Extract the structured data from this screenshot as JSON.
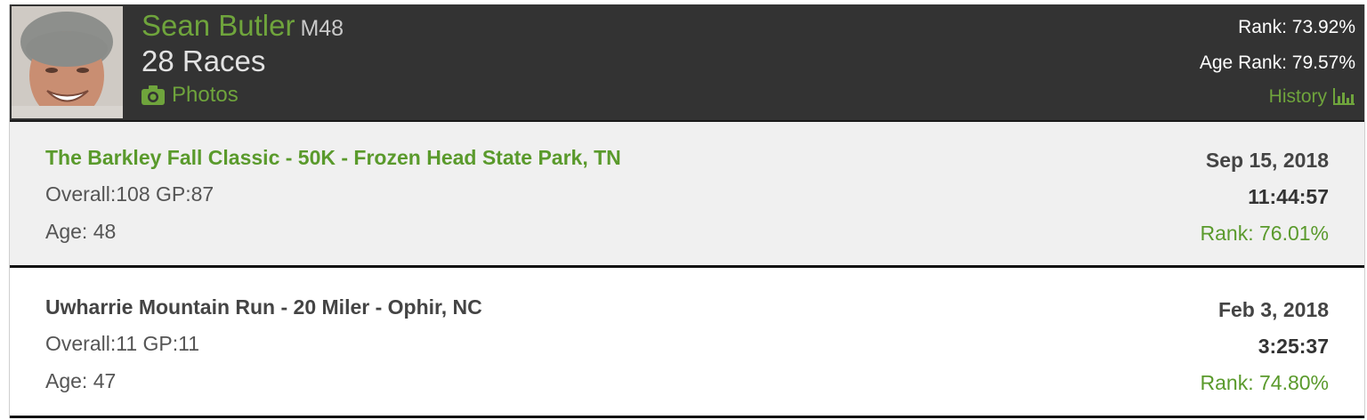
{
  "runner": {
    "name": "Sean Butler",
    "age_group": "M48",
    "races": "28 Races",
    "photos_label": "Photos",
    "rank": "Rank: 73.92%",
    "age_rank": "Age Rank: 79.57%",
    "history_label": "History"
  },
  "icons": {
    "camera": "camera-icon",
    "bar_chart": "bar-chart-icon"
  },
  "colors": {
    "accent_green": "#6fa43c",
    "header_bg": "#333333"
  },
  "results": [
    {
      "title": "The Barkley Fall Classic - 50K - Frozen Head State Park, TN",
      "overall": "Overall:108 GP:87",
      "age": "Age: 48",
      "date": "Sep 15, 2018",
      "time": "11:44:57",
      "rank": "Rank: 76.01%"
    },
    {
      "title": "Uwharrie Mountain Run - 20 Miler - Ophir, NC",
      "overall": "Overall:11 GP:11",
      "age": "Age: 47",
      "date": "Feb 3, 2018",
      "time": "3:25:37",
      "rank": "Rank: 74.80%"
    }
  ]
}
